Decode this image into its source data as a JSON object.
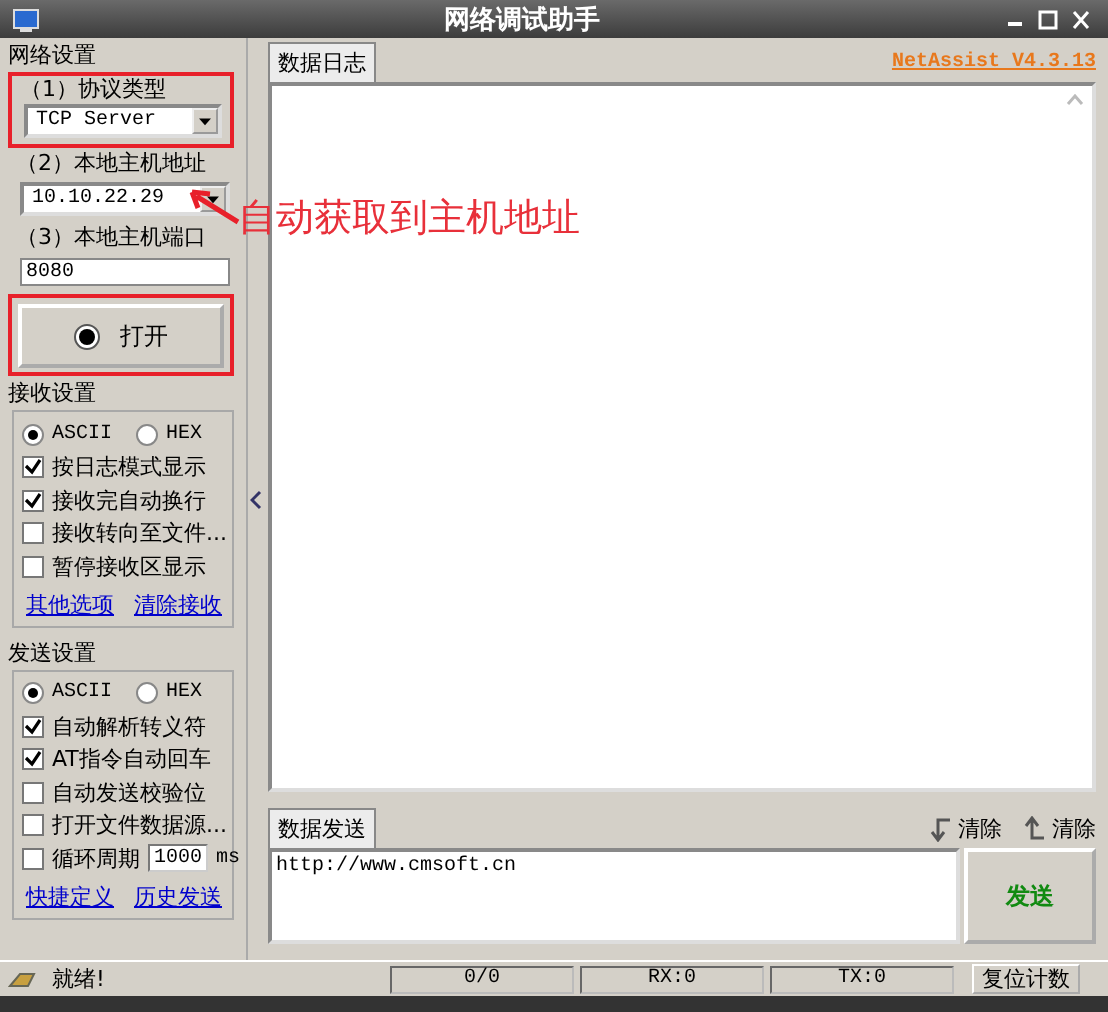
{
  "window": {
    "title": "网络调试助手"
  },
  "network_settings": {
    "title": "网络设置",
    "protocol": {
      "label": "（1）协议类型",
      "value": "TCP Server"
    },
    "host": {
      "label": "（2）本地主机地址",
      "value": "10.10.22.29"
    },
    "port": {
      "label": "（3）本地主机端口",
      "value": "8080"
    },
    "open_button": "打开"
  },
  "annotation": {
    "text": "自动获取到主机地址"
  },
  "receive_settings": {
    "title": "接收设置",
    "encodings": [
      {
        "label": "ASCII",
        "selected": true
      },
      {
        "label": "HEX",
        "selected": false
      }
    ],
    "options": [
      {
        "kind": "checkbox",
        "label": "按日志模式显示",
        "checked": true
      },
      {
        "kind": "checkbox",
        "label": "接收完自动换行",
        "checked": true
      },
      {
        "kind": "checkbox",
        "label": "接收转向至文件...",
        "checked": false
      },
      {
        "kind": "checkbox",
        "label": "暂停接收区显示",
        "checked": false
      }
    ],
    "links": [
      "其他选项",
      "清除接收"
    ]
  },
  "send_settings": {
    "title": "发送设置",
    "encodings": [
      {
        "label": "ASCII",
        "selected": true
      },
      {
        "label": "HEX",
        "selected": false
      }
    ],
    "options": [
      {
        "kind": "checkbox",
        "label": "自动解析转义符",
        "checked": true
      },
      {
        "kind": "checkbox",
        "label": "AT指令自动回车",
        "checked": true
      },
      {
        "kind": "checkbox",
        "label": "自动发送校验位",
        "checked": false
      },
      {
        "kind": "checkbox",
        "label": "打开文件数据源...",
        "checked": false
      },
      {
        "kind": "interval",
        "label": "循环周期",
        "checked": false,
        "value": "1000",
        "unit": "ms"
      }
    ],
    "links": [
      "快捷定义",
      "历史发送"
    ]
  },
  "log": {
    "tab": "数据日志",
    "brand": "NetAssist V4.3.13"
  },
  "send": {
    "tab": "数据发送",
    "actions": [
      "清除",
      "清除"
    ],
    "value": "http://www.cmsoft.cn",
    "button": "发送"
  },
  "status_bar": {
    "message": "就绪!",
    "counters": [
      "0/0",
      "RX:0",
      "TX:0"
    ],
    "reset_button": "复位计数"
  }
}
